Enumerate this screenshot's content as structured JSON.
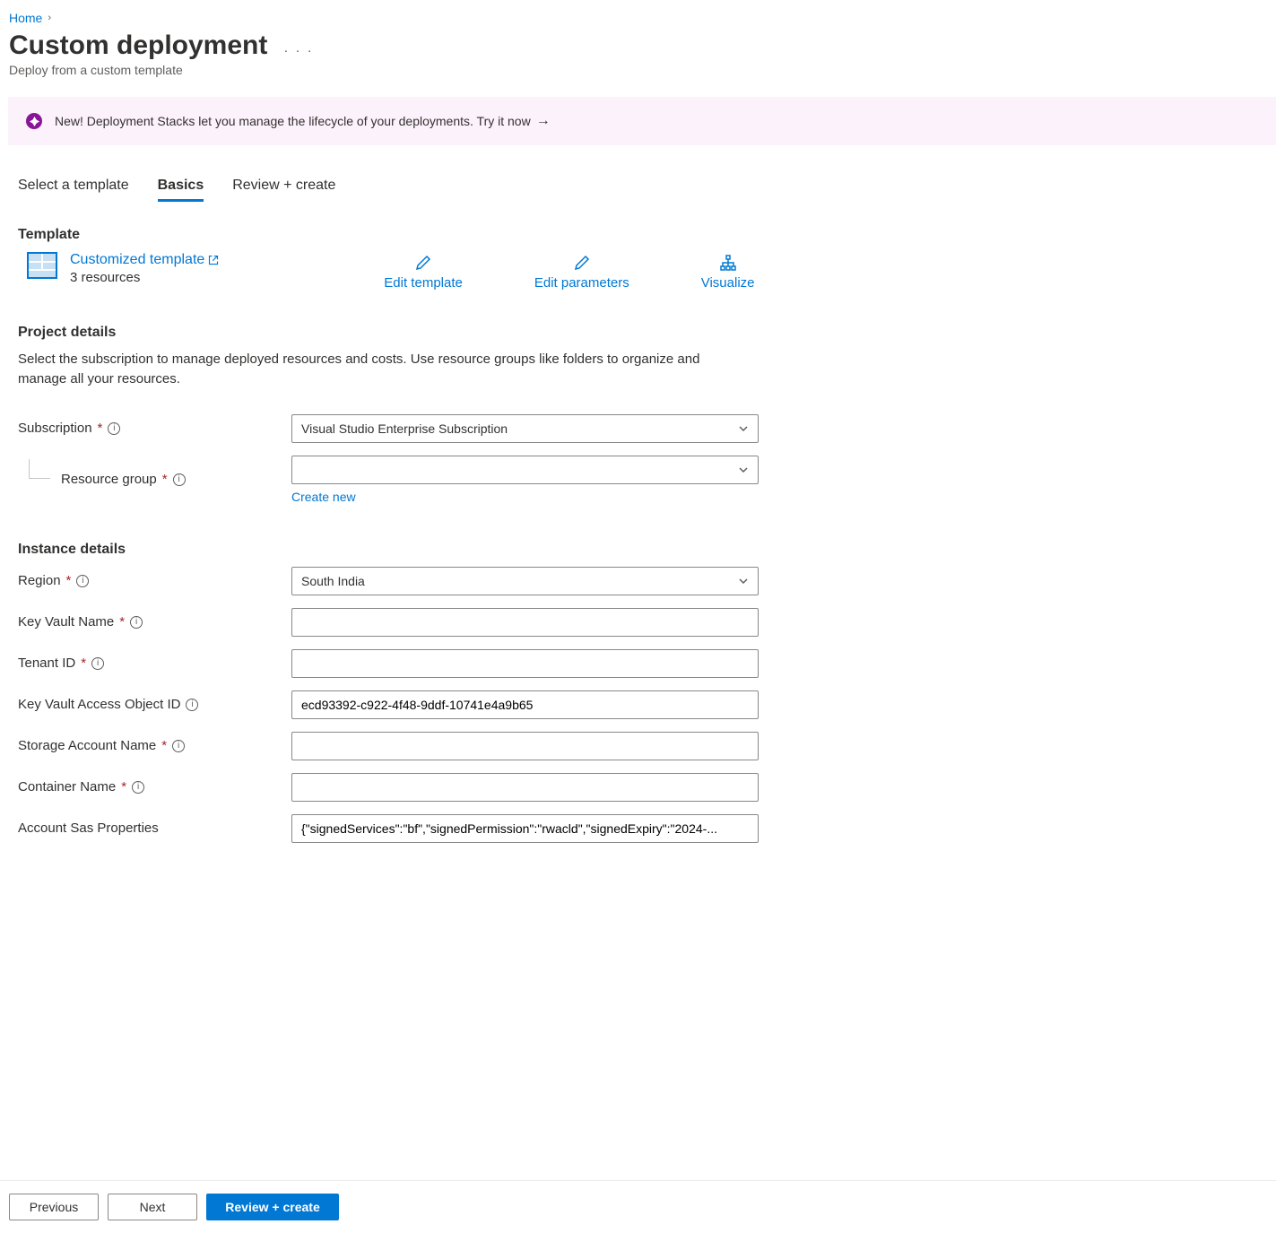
{
  "breadcrumb": {
    "home": "Home"
  },
  "header": {
    "title": "Custom deployment",
    "subtitle": "Deploy from a custom template"
  },
  "banner": {
    "text": "New! Deployment Stacks let you manage the lifecycle of your deployments. Try it now"
  },
  "tabs": {
    "select_template": "Select a template",
    "basics": "Basics",
    "review": "Review + create"
  },
  "template": {
    "section_title": "Template",
    "link": "Customized template",
    "resources": "3 resources",
    "actions": {
      "edit_template": "Edit template",
      "edit_parameters": "Edit parameters",
      "visualize": "Visualize"
    }
  },
  "project": {
    "section_title": "Project details",
    "description": "Select the subscription to manage deployed resources and costs. Use resource groups like folders to organize and manage all your resources.",
    "subscription": {
      "label": "Subscription",
      "value": "Visual Studio Enterprise Subscription"
    },
    "resource_group": {
      "label": "Resource group",
      "value": "",
      "create_new": "Create new"
    }
  },
  "instance": {
    "section_title": "Instance details",
    "region": {
      "label": "Region",
      "value": "South India"
    },
    "key_vault_name": {
      "label": "Key Vault Name",
      "value": ""
    },
    "tenant_id": {
      "label": "Tenant ID",
      "value": ""
    },
    "kv_access_object_id": {
      "label": "Key Vault Access Object ID",
      "value": "ecd93392-c922-4f48-9ddf-10741e4a9b65"
    },
    "storage_account_name": {
      "label": "Storage Account Name",
      "value": ""
    },
    "container_name": {
      "label": "Container Name",
      "value": ""
    },
    "account_sas_properties": {
      "label": "Account Sas Properties",
      "value": "{\"signedServices\":\"bf\",\"signedPermission\":\"rwacld\",\"signedExpiry\":\"2024-..."
    }
  },
  "footer": {
    "previous": "Previous",
    "next": "Next",
    "review": "Review + create"
  }
}
